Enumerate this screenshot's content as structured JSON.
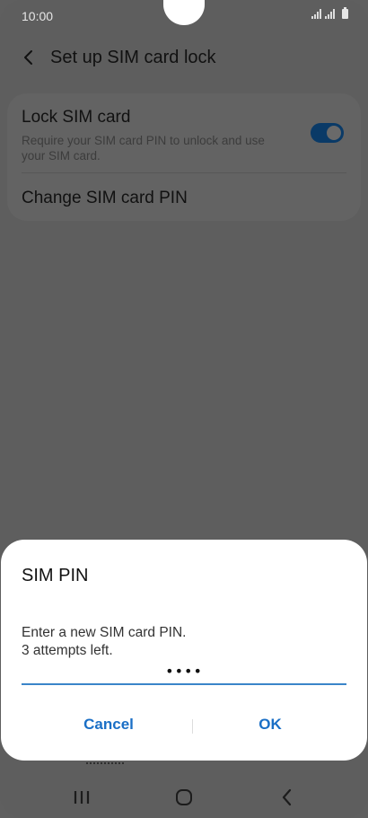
{
  "status_bar": {
    "time": "10:00"
  },
  "header": {
    "title": "Set up SIM card lock",
    "back_icon": "back-arrow-icon"
  },
  "settings": {
    "lock_sim": {
      "title": "Lock SIM card",
      "subtitle": "Require your SIM card PIN to unlock and use your SIM card.",
      "enabled": true
    },
    "change_pin": {
      "title": "Change SIM card PIN"
    }
  },
  "dialog": {
    "title": "SIM PIN",
    "message_line1": "Enter a new SIM card PIN.",
    "message_line2": "3 attempts left.",
    "pin_value": "••••",
    "cancel_label": "Cancel",
    "ok_label": "OK"
  },
  "colors": {
    "accent": "#1a6fc6",
    "toggle_on": "#0a3a67",
    "dim_background": "#5e5e5e"
  },
  "nav_bar": {
    "recents_icon": "recents-icon",
    "home_icon": "home-icon",
    "back_icon": "back-icon"
  }
}
